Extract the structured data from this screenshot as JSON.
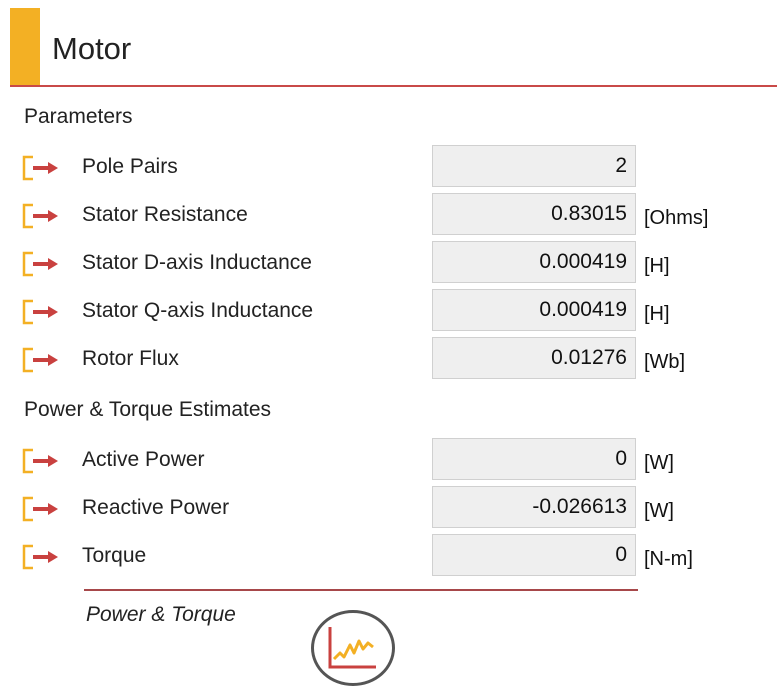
{
  "header": {
    "title": "Motor"
  },
  "parameters": {
    "section_label": "Parameters",
    "rows": [
      {
        "label": "Pole Pairs",
        "value": "2",
        "unit": ""
      },
      {
        "label": "Stator Resistance",
        "value": "0.83015",
        "unit": "[Ohms]"
      },
      {
        "label": "Stator D-axis Inductance",
        "value": "0.000419",
        "unit": "[H]"
      },
      {
        "label": "Stator Q-axis Inductance",
        "value": "0.000419",
        "unit": "[H]"
      },
      {
        "label": "Rotor Flux",
        "value": "0.01276",
        "unit": "[Wb]"
      }
    ]
  },
  "estimates": {
    "section_label": "Power & Torque Estimates",
    "rows": [
      {
        "label": "Active Power",
        "value": "0",
        "unit": "[W]"
      },
      {
        "label": "Reactive Power",
        "value": "-0.026613",
        "unit": "[W]"
      },
      {
        "label": "Torque",
        "value": "0",
        "unit": "[N-m]"
      }
    ]
  },
  "footer": {
    "label": "Power & Torque"
  },
  "icons": {
    "row": "arrow-into-box-icon",
    "chart": "line-chart-icon"
  },
  "colors": {
    "accent": "#f3b024",
    "rule": "#c94a48",
    "arrow": "#c9413f"
  }
}
